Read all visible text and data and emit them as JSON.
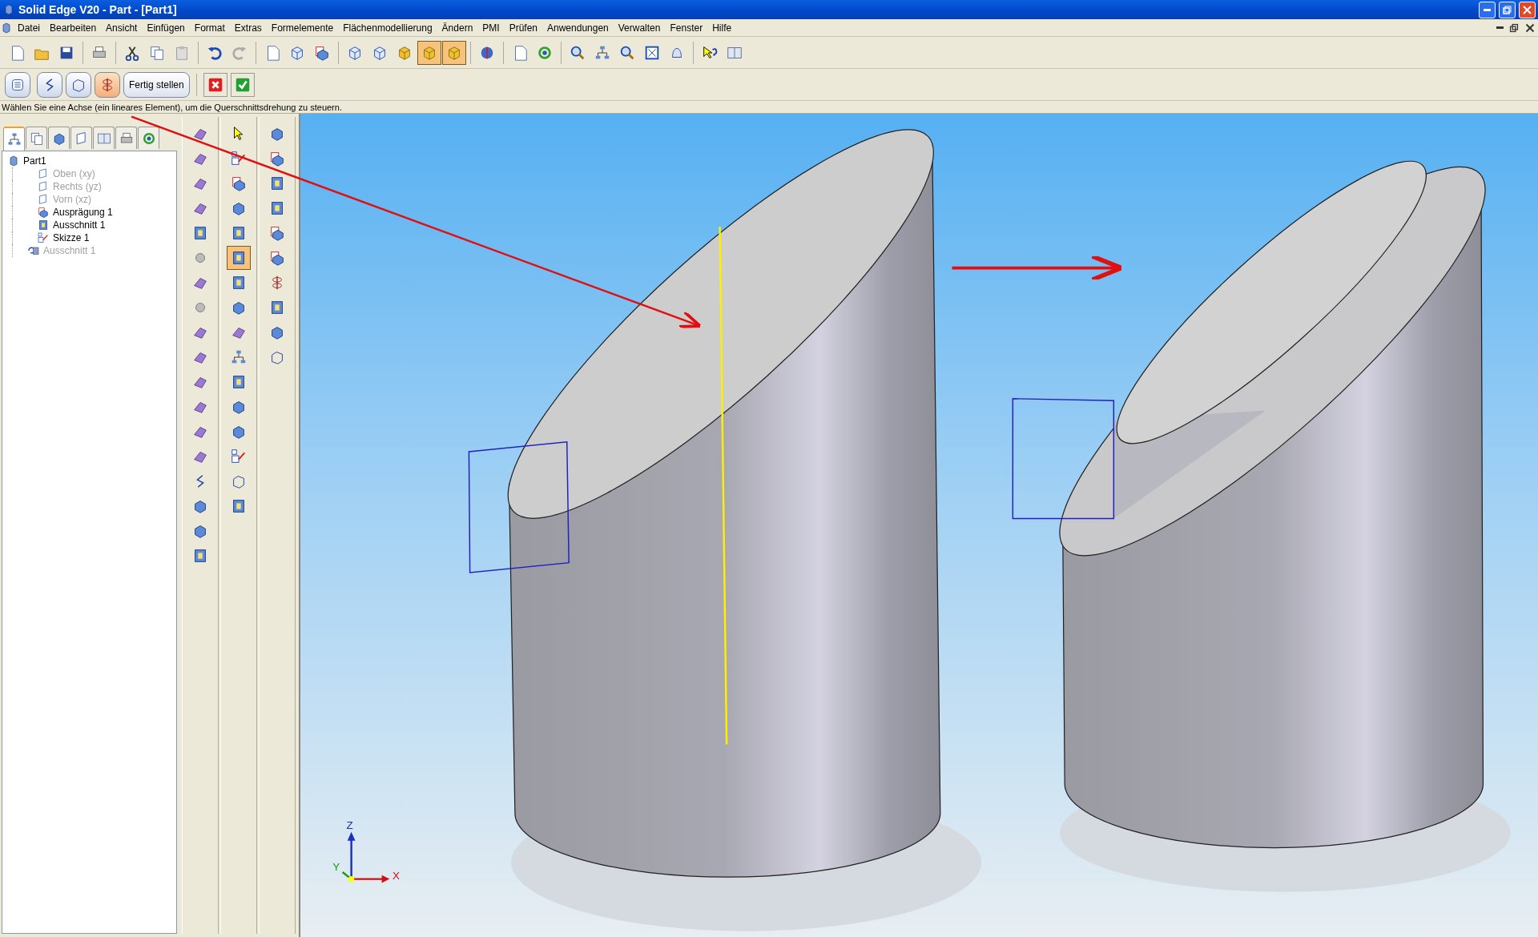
{
  "window": {
    "title": "Solid Edge V20 - Part - [Part1]"
  },
  "menu": [
    "Datei",
    "Bearbeiten",
    "Ansicht",
    "Einfügen",
    "Format",
    "Extras",
    "Formelemente",
    "Flächenmodellierung",
    "Ändern",
    "PMI",
    "Prüfen",
    "Anwendungen",
    "Verwalten",
    "Fenster",
    "Hilfe"
  ],
  "main_toolbar": [
    {
      "pressed": false
    },
    {
      "pressed": false
    },
    {
      "pressed": false
    },
    {
      "pressed": false
    },
    {
      "pressed": false
    },
    {
      "pressed": false
    },
    {
      "pressed": false
    },
    {
      "pressed": false
    },
    {
      "pressed": false
    },
    {
      "pressed": false
    },
    {
      "pressed": false
    },
    {
      "pressed": false
    },
    {
      "pressed": false
    },
    {
      "pressed": false
    },
    {
      "pressed": false
    },
    {
      "pressed": true
    },
    {
      "pressed": true
    },
    {
      "pressed": false
    },
    {
      "pressed": false
    },
    {
      "pressed": false
    },
    {
      "pressed": false
    },
    {
      "pressed": false
    },
    {
      "pressed": false
    },
    {
      "pressed": false
    },
    {
      "pressed": false
    },
    {
      "pressed": false
    },
    {
      "pressed": false
    }
  ],
  "command_bar": {
    "steps": [
      {
        "selected": false
      },
      {
        "selected": false
      },
      {
        "selected": false
      },
      {
        "selected": true
      }
    ],
    "finish_button": "Fertig stellen"
  },
  "prompt": "Wählen Sie eine Achse (ein lineares Element), um die Querschnittsdrehung zu steuern.",
  "pathfinder": {
    "tabs": [
      {
        "selected": true
      },
      {
        "selected": false
      },
      {
        "selected": false
      },
      {
        "selected": false
      },
      {
        "selected": false
      },
      {
        "selected": false
      },
      {
        "selected": false
      }
    ],
    "tree": {
      "label": "Part1",
      "children": [
        {
          "label": "Oben (xy)",
          "dimmed": true,
          "kind": "plane"
        },
        {
          "label": "Rechts (yz)",
          "dimmed": true,
          "kind": "plane"
        },
        {
          "label": "Vorn (xz)",
          "dimmed": true,
          "kind": "plane"
        },
        {
          "label": "Ausprägung 1",
          "dimmed": false,
          "kind": "protrusion"
        },
        {
          "label": "Ausschnitt 1",
          "dimmed": false,
          "kind": "cutout"
        },
        {
          "label": "Skizze 1",
          "dimmed": false,
          "kind": "sketch"
        },
        {
          "label": "Ausschnitt 1",
          "dimmed": true,
          "kind": "rollback"
        }
      ]
    }
  },
  "tool_palette": [
    [
      {
        "pressed": false
      },
      {
        "pressed": false
      },
      {
        "pressed": false
      },
      {
        "pressed": false
      },
      {
        "pressed": false
      },
      {
        "pressed": false
      },
      {
        "pressed": false
      },
      {
        "pressed": false
      },
      {
        "pressed": false
      },
      {
        "pressed": false
      },
      {
        "pressed": false
      },
      {
        "pressed": false
      },
      {
        "pressed": false
      },
      {
        "pressed": false
      },
      {
        "pressed": false
      },
      {
        "pressed": false
      },
      {
        "pressed": false
      },
      {
        "pressed": false
      }
    ],
    [
      {
        "pressed": false
      },
      {
        "pressed": false
      },
      {
        "pressed": false
      },
      {
        "pressed": false
      },
      {
        "pressed": false
      },
      {
        "pressed": true
      },
      {
        "pressed": false
      },
      {
        "pressed": false
      },
      {
        "pressed": false
      },
      {
        "pressed": false
      },
      {
        "pressed": false
      },
      {
        "pressed": false
      },
      {
        "pressed": false
      },
      {
        "pressed": false
      },
      {
        "pressed": false
      },
      {
        "pressed": false
      }
    ],
    [
      {
        "pressed": false
      },
      {
        "pressed": false
      },
      {
        "pressed": false
      },
      {
        "pressed": false
      },
      {
        "pressed": false
      },
      {
        "pressed": false
      },
      {
        "pressed": false
      },
      {
        "pressed": false
      },
      {
        "pressed": false
      },
      {
        "pressed": false
      }
    ]
  ],
  "triad": {
    "x": "X",
    "y": "Y",
    "z": "Z"
  }
}
